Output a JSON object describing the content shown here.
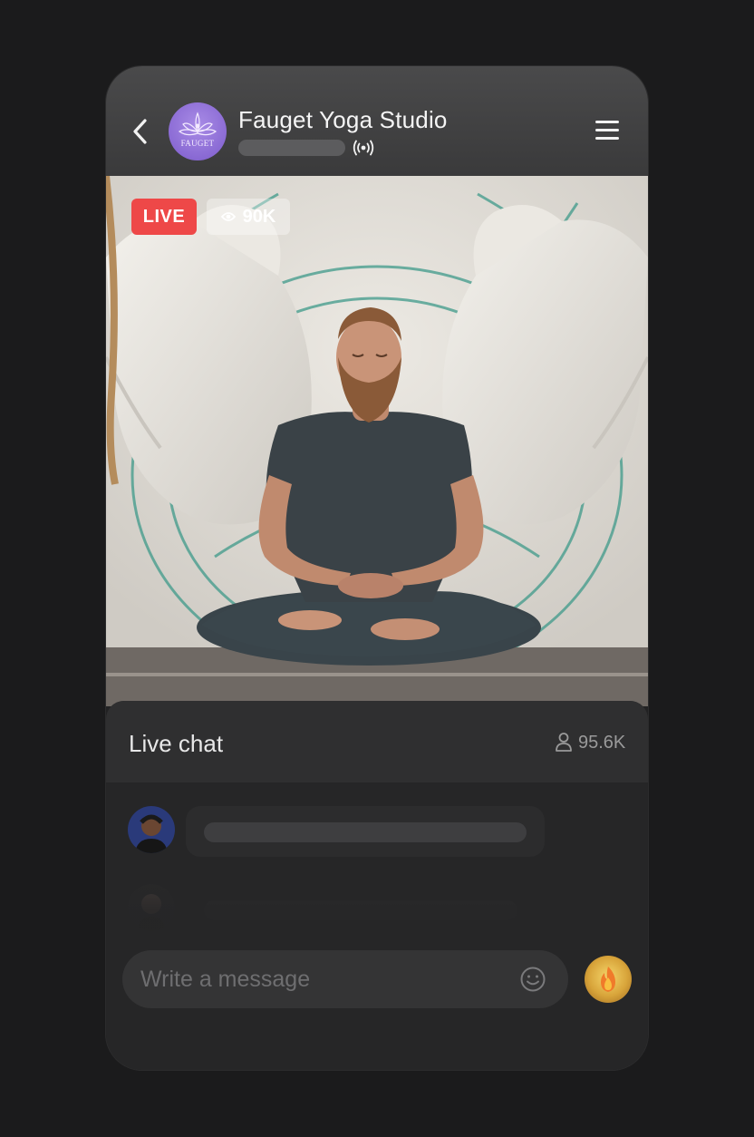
{
  "header": {
    "studio_name": "Fauget Yoga Studio",
    "logo_text": "FAUGET",
    "status_icon": "broadcast-icon",
    "back_icon": "chevron-left-icon",
    "menu_icon": "hamburger-menu-icon"
  },
  "stream": {
    "live_label": "LIVE",
    "viewers_icon": "eye-icon",
    "viewers": "90K"
  },
  "chat": {
    "title": "Live chat",
    "participants_icon": "user-icon",
    "participants": "95.6K",
    "input_placeholder": "Write a message",
    "emoji_icon": "smiley-icon",
    "reaction_icon": "fire-icon"
  },
  "colors": {
    "background": "#1b1b1c",
    "live_badge": "#ee4848",
    "avatar_logo": "#8a6ad4"
  }
}
